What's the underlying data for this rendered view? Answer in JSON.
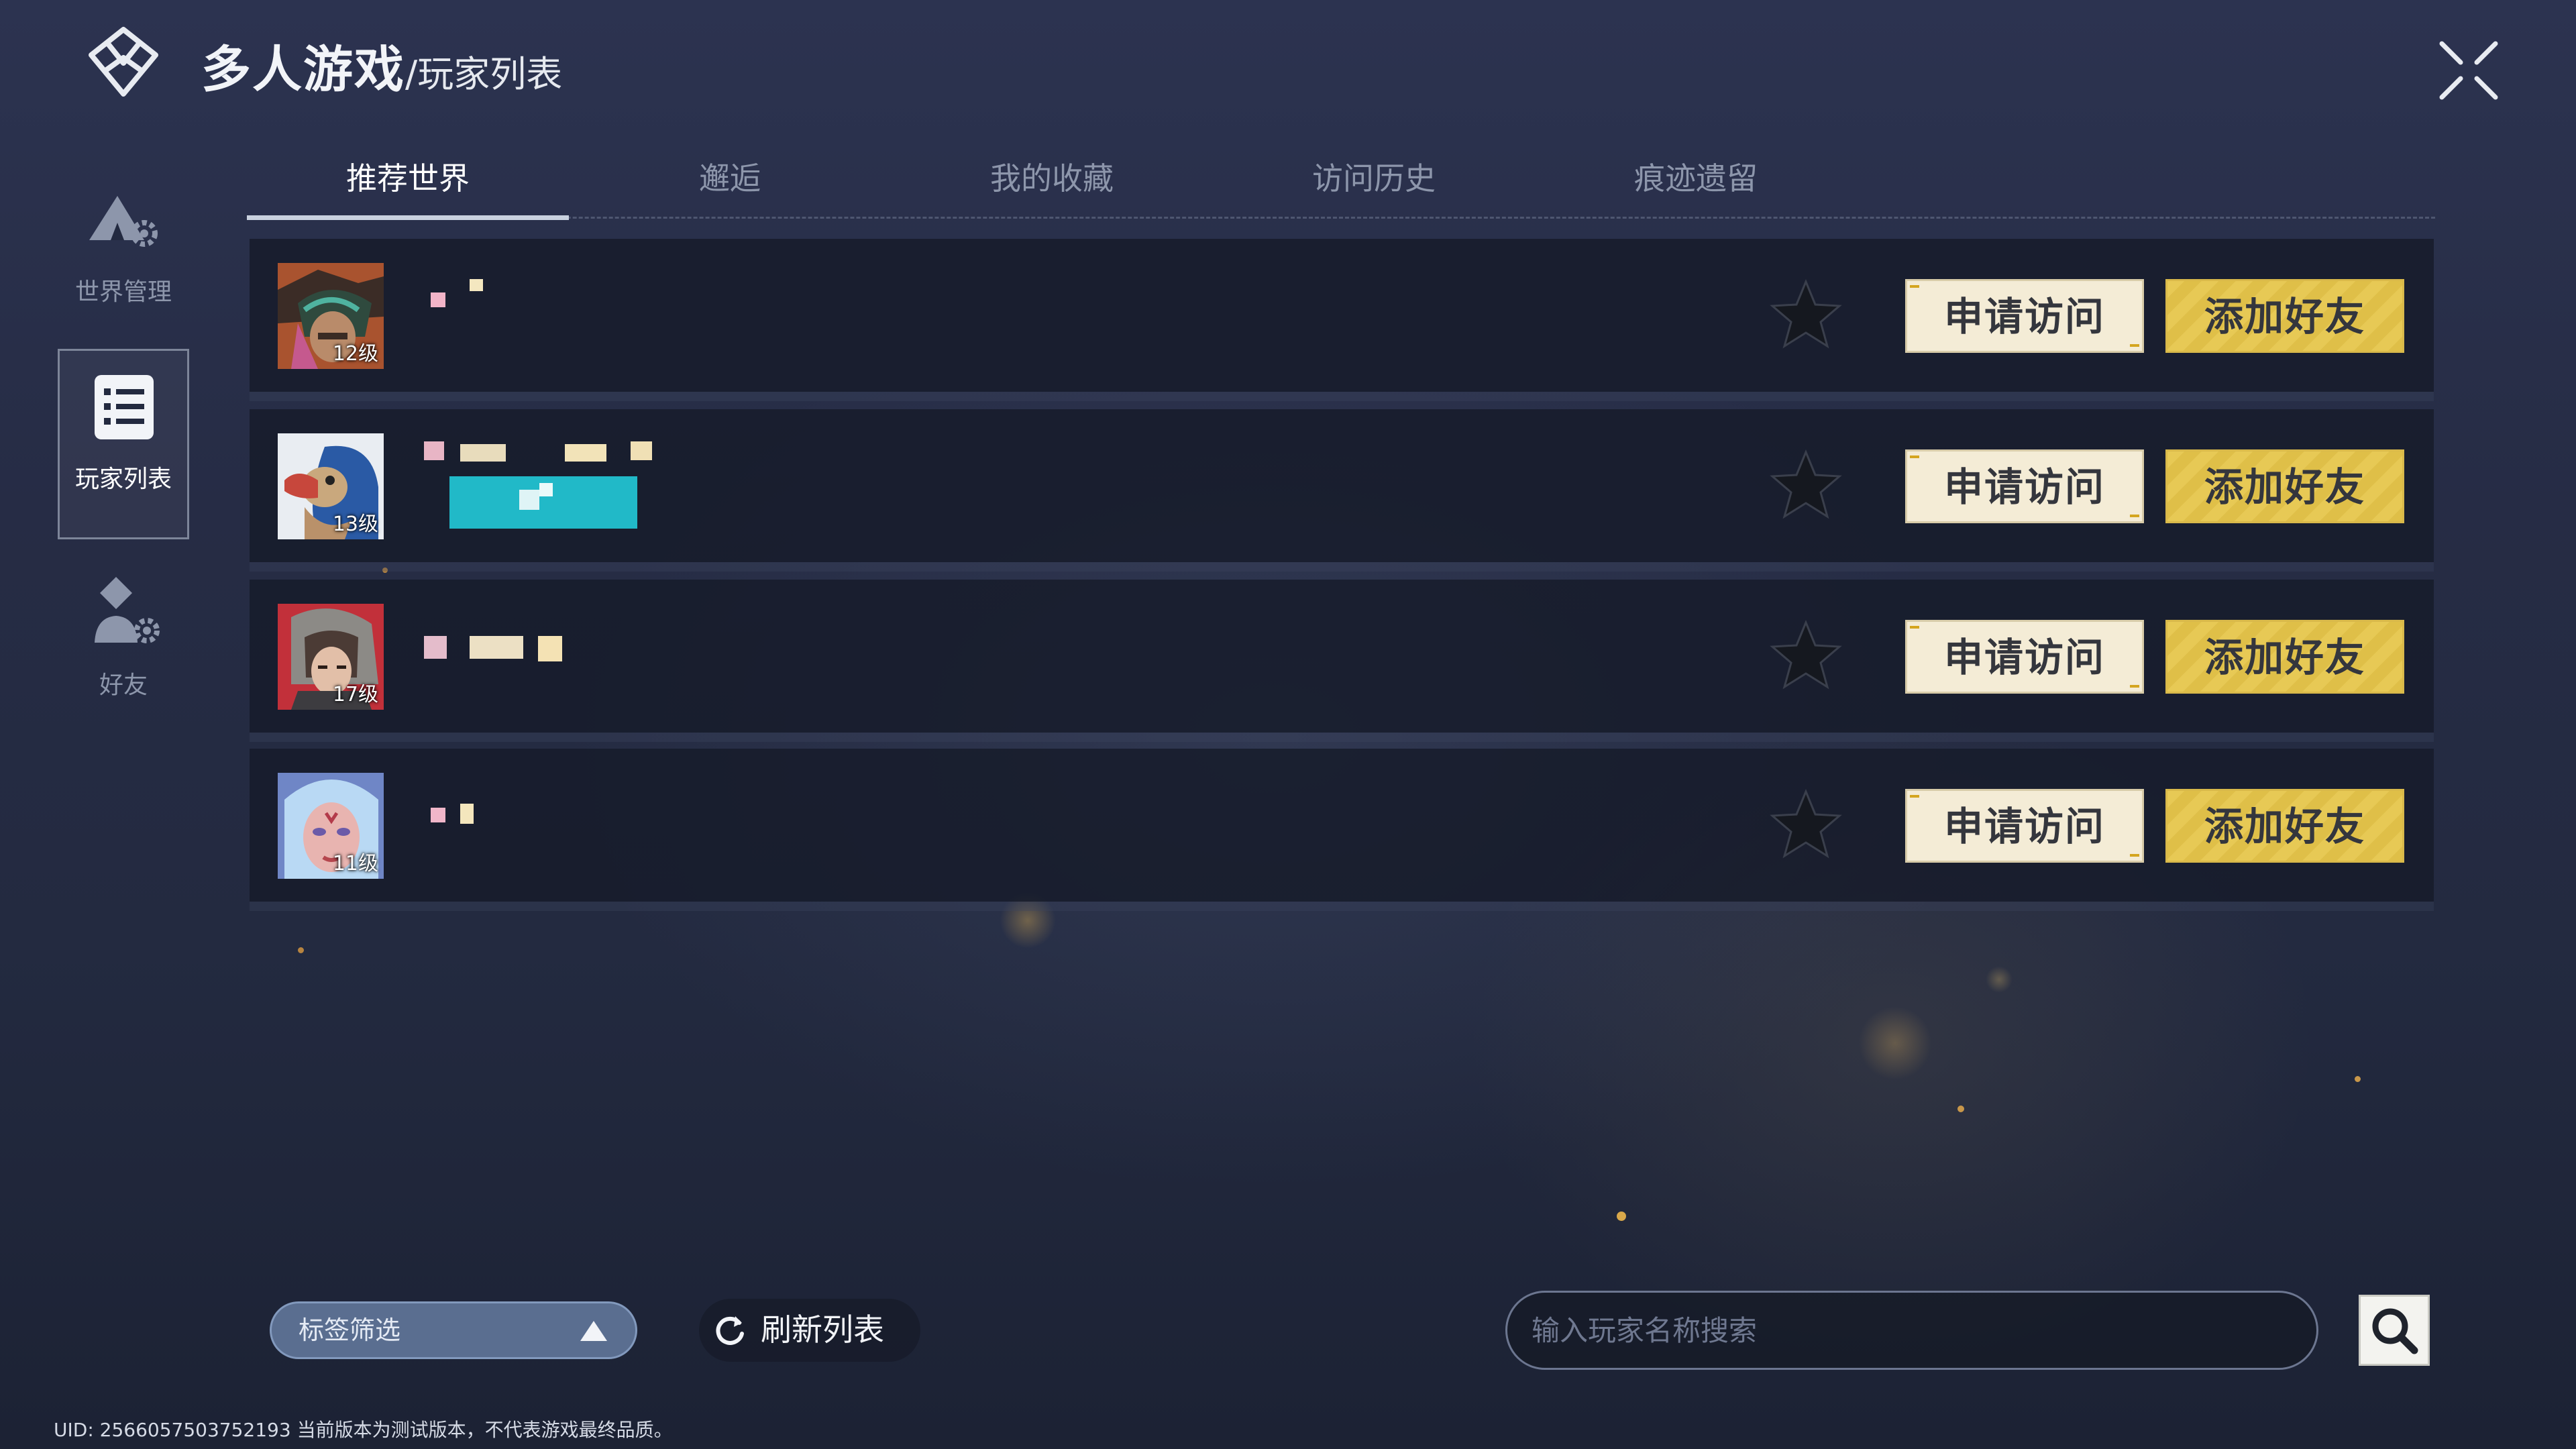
{
  "header": {
    "title_main": "多人游戏",
    "title_sub": "/玩家列表"
  },
  "sidebar": {
    "items": [
      {
        "label": "世界管理",
        "icon": "camp-gear-icon",
        "active": false
      },
      {
        "label": "玩家列表",
        "icon": "list-icon",
        "active": true
      },
      {
        "label": "好友",
        "icon": "friend-gear-icon",
        "active": false
      }
    ]
  },
  "tabs": [
    {
      "label": "推荐世界",
      "active": true
    },
    {
      "label": "邂逅",
      "active": false
    },
    {
      "label": "我的收藏",
      "active": false
    },
    {
      "label": "访问历史",
      "active": false
    },
    {
      "label": "痕迹遗留",
      "active": false
    }
  ],
  "players": [
    {
      "level": "12级",
      "avatar": "fox-hooded-avatar",
      "visit_label": "申请访问",
      "friend_label": "添加好友"
    },
    {
      "level": "13级",
      "avatar": "dodo-bird-avatar",
      "visit_label": "申请访问",
      "friend_label": "添加好友"
    },
    {
      "level": "17级",
      "avatar": "helmet-girl-avatar",
      "visit_label": "申请访问",
      "friend_label": "添加好友"
    },
    {
      "level": "11级",
      "avatar": "pale-girl-avatar",
      "visit_label": "申请访问",
      "friend_label": "添加好友"
    }
  ],
  "bottom": {
    "filter_label": "标签筛选",
    "refresh_label": "刷新列表",
    "search_placeholder": "输入玩家名称搜索"
  },
  "footer": {
    "uid_text": "UID: 2566057503752193 当前版本为测试版本，不代表游戏最终品质。"
  },
  "colors": {
    "visit_button_bg": "#f4ecd6",
    "friend_button_bg": "#e7c955",
    "filter_bg": "#5a6e90",
    "tag_badge": "#21b9c8"
  }
}
